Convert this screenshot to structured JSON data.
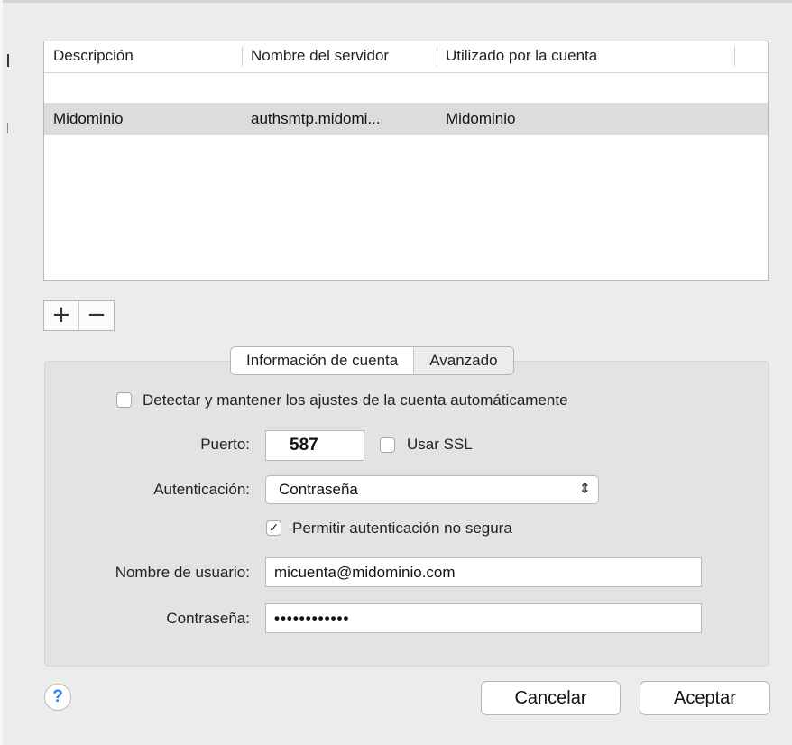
{
  "table": {
    "columns": [
      "Descripción",
      "Nombre del servidor",
      "Utilizado por la cuenta"
    ],
    "rows": [
      {
        "description": "Midominio",
        "server": "authsmtp.midomi...",
        "account": "Midominio"
      }
    ]
  },
  "list_buttons": {
    "add": "+",
    "remove": "−"
  },
  "tabs": [
    "Información de cuenta",
    "Avanzado"
  ],
  "form": {
    "auto_detect_label": "Detectar y mantener los ajustes de la cuenta automáticamente",
    "auto_detect_checked": false,
    "port_label": "Puerto:",
    "port_value": "587",
    "ssl_label": "Usar SSL",
    "ssl_checked": false,
    "auth_label": "Autenticación:",
    "auth_value": "Contraseña",
    "insecure_label": "Permitir autenticación no segura",
    "insecure_checked": true,
    "username_label": "Nombre de usuario:",
    "username_value": "micuenta@midominio.com",
    "password_label": "Contraseña:",
    "password_value": "••••••••••••"
  },
  "footer": {
    "help": "?",
    "cancel": "Cancelar",
    "accept": "Aceptar"
  }
}
